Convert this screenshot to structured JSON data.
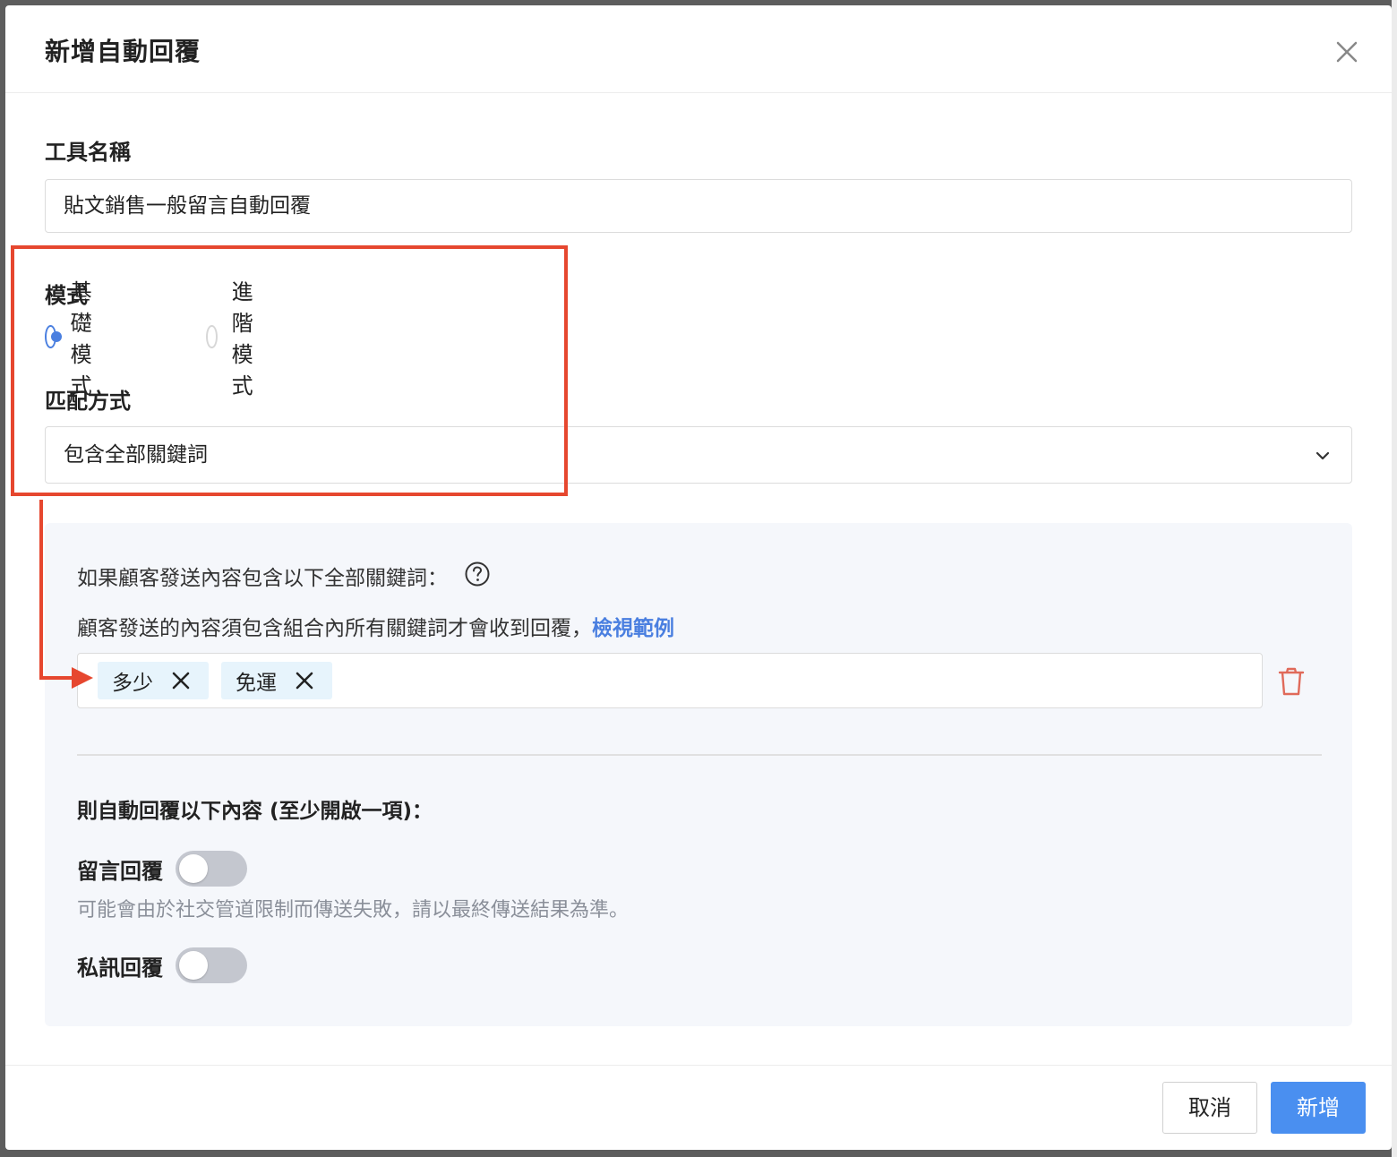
{
  "modal": {
    "title": "新增自動回覆"
  },
  "tool_name": {
    "label": "工具名稱",
    "value": "貼文銷售一般留言自動回覆"
  },
  "mode": {
    "label": "模式",
    "options": [
      {
        "label": "基礎模式",
        "selected": true
      },
      {
        "label": "進階模式",
        "selected": false
      }
    ]
  },
  "match": {
    "label": "匹配方式",
    "selected": "包含全部關鍵詞"
  },
  "rule": {
    "condition": "如果顧客發送內容包含以下全部關鍵詞：",
    "description": "顧客發送的內容須包含組合內所有關鍵詞才會收到回覆，",
    "example_link": "檢視範例",
    "keywords": [
      "多少",
      "免運"
    ]
  },
  "reply": {
    "heading": "則自動回覆以下內容 (至少開啟一項)：",
    "comment_reply_label": "留言回覆",
    "comment_reply_on": false,
    "comment_hint": "可能會由於社交管道限制而傳送失敗，請以最終傳送結果為準。",
    "dm_reply_label": "私訊回覆",
    "dm_reply_on": false
  },
  "footer": {
    "cancel_label": "取消",
    "submit_label": "新增"
  },
  "colors": {
    "accent": "#4a7fe0",
    "primary_button": "#4a8ff0",
    "annotation": "#e6472f",
    "tag_bg": "#e7f4fc",
    "danger_icon": "#e06a5a"
  }
}
